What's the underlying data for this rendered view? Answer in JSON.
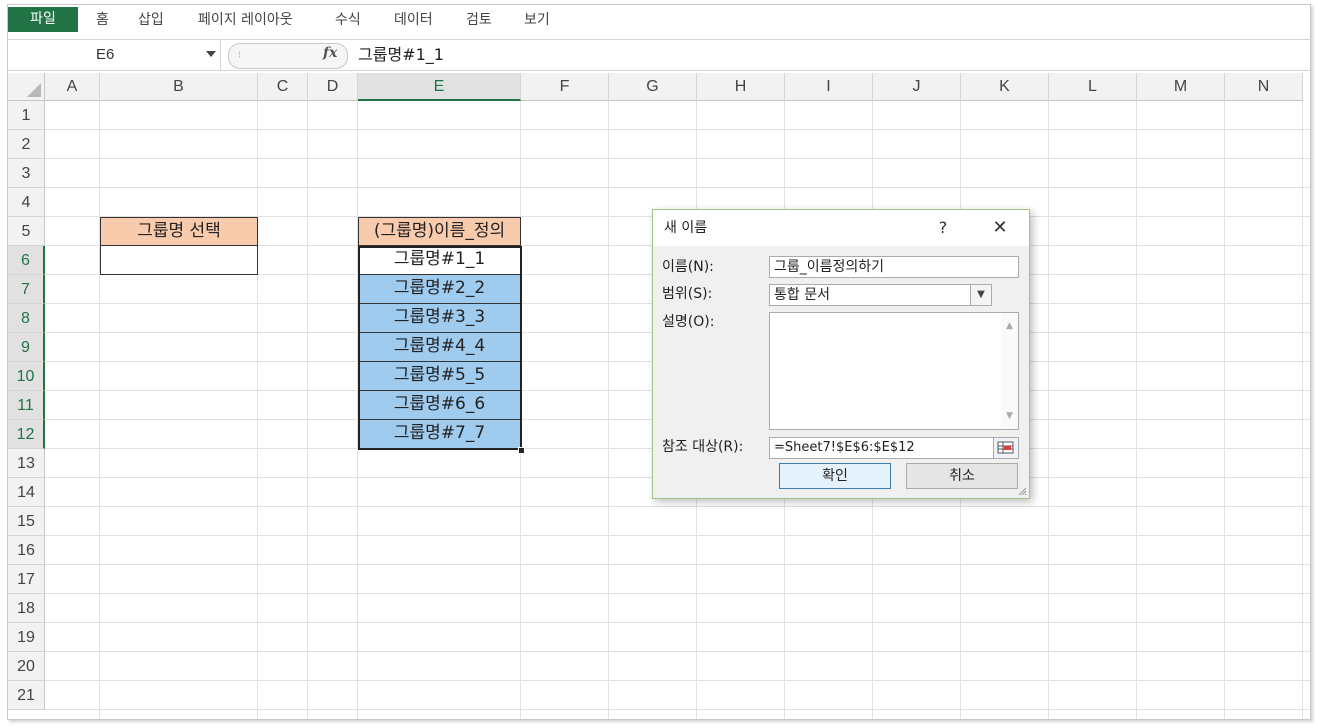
{
  "menu": {
    "file": "파일",
    "items": [
      "홈",
      "삽입",
      "페이지 레이아웃",
      "수식",
      "데이터",
      "검토",
      "보기"
    ]
  },
  "formula_bar": {
    "name_box": "E6",
    "fx_label": "fx",
    "formula": "그룹명#1_1"
  },
  "columns": [
    "A",
    "B",
    "C",
    "D",
    "E",
    "F",
    "G",
    "H",
    "I",
    "J",
    "K",
    "L",
    "M",
    "N"
  ],
  "selected_column": "E",
  "rows": [
    "1",
    "2",
    "3",
    "4",
    "5",
    "6",
    "7",
    "8",
    "9",
    "10",
    "11",
    "12",
    "13",
    "14",
    "15",
    "16",
    "17",
    "18",
    "19",
    "20",
    "21"
  ],
  "selected_rows": [
    "6",
    "7",
    "8",
    "9",
    "10",
    "11",
    "12"
  ],
  "cells": {
    "b5": "그룹명 선택",
    "b6": "",
    "e5": "(그룹명)이름_정의",
    "e6": "그룹명#1_1",
    "e7": "그룹명#2_2",
    "e8": "그룹명#3_3",
    "e9": "그룹명#4_4",
    "e10": "그룹명#5_5",
    "e11": "그룹명#6_6",
    "e12": "그룹명#7_7"
  },
  "colors": {
    "header_fill": "#f8cbad",
    "list_fill": "#9fcbef",
    "excel_green": "#217346"
  },
  "dialog": {
    "title": "새 이름",
    "help": "?",
    "close": "✕",
    "name_label": "이름(N):",
    "name_value": "그룹_이름정의하기",
    "scope_label": "범위(S):",
    "scope_value": "통합 문서",
    "comment_label": "설명(O):",
    "comment_value": "",
    "refers_label": "참조 대상(R):",
    "refers_value": "=Sheet7!$E$6:$E$12",
    "ok": "확인",
    "cancel": "취소"
  }
}
